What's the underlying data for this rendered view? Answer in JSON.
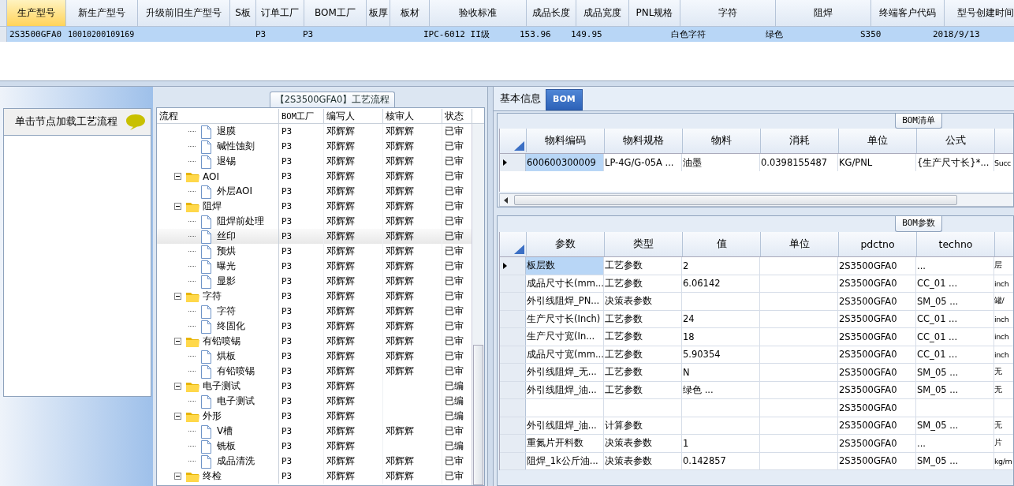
{
  "top_grid": {
    "columns": [
      {
        "label": "生产型号",
        "selected": true
      },
      {
        "label": "新生产型号",
        "selected": false
      },
      {
        "label": "升级前旧生产型号",
        "selected": false
      },
      {
        "label": "S板",
        "selected": false
      },
      {
        "label": "订单工厂",
        "selected": false
      },
      {
        "label": "BOM工厂",
        "selected": false
      },
      {
        "label": "板厚",
        "selected": false
      },
      {
        "label": "板材",
        "selected": false
      },
      {
        "label": "验收标准",
        "selected": false
      },
      {
        "label": "成品长度",
        "selected": false
      },
      {
        "label": "成品宽度",
        "selected": false
      },
      {
        "label": "PNL规格",
        "selected": false
      },
      {
        "label": "字符",
        "selected": false
      },
      {
        "label": "阻焊",
        "selected": false
      },
      {
        "label": "终端客户代码",
        "selected": false
      },
      {
        "label": "型号创建时间",
        "selected": false
      }
    ],
    "rows": [
      {
        "selected": true,
        "cells": [
          "2S3500GFA0",
          "10010200109169",
          "",
          "",
          "P3",
          "P3",
          "",
          "",
          "IPC-6012 II级",
          "153.96",
          "149.95",
          "",
          "白色字符",
          "绿色",
          "S350",
          "2018/9/13"
        ]
      }
    ]
  },
  "left_panel": {
    "hint": "单击节点加载工艺流程"
  },
  "process_panel": {
    "title": "【2S3500GFA0】工艺流程",
    "columns": [
      "流程",
      "BOM工厂",
      "编写人",
      "核审人",
      "状态"
    ],
    "tree": [
      {
        "children": [
          {
            "label": "退膜",
            "selected": false,
            "cells": [
              "P3",
              "邓辉辉",
              "邓辉辉",
              "已审"
            ]
          },
          {
            "label": "碱性蚀刻",
            "selected": false,
            "cells": [
              "P3",
              "邓辉辉",
              "邓辉辉",
              "已审"
            ]
          },
          {
            "label": "退锡",
            "selected": false,
            "cells": [
              "P3",
              "邓辉辉",
              "邓辉辉",
              "已审"
            ]
          }
        ]
      },
      {
        "label": "AOI",
        "selected": false,
        "expanded": true,
        "cells": [
          "P3",
          "邓辉辉",
          "邓辉辉",
          "已审"
        ],
        "children": [
          {
            "label": "外层AOI",
            "selected": false,
            "cells": [
              "P3",
              "邓辉辉",
              "邓辉辉",
              "已审"
            ]
          }
        ]
      },
      {
        "label": "阻焊",
        "selected": false,
        "expanded": true,
        "cells": [
          "P3",
          "邓辉辉",
          "邓辉辉",
          "已审"
        ],
        "children": [
          {
            "label": "阻焊前处理",
            "selected": false,
            "cells": [
              "P3",
              "邓辉辉",
              "邓辉辉",
              "已审"
            ]
          },
          {
            "label": "丝印",
            "selected": true,
            "cells": [
              "P3",
              "邓辉辉",
              "邓辉辉",
              "已审"
            ]
          },
          {
            "label": "预烘",
            "selected": false,
            "cells": [
              "P3",
              "邓辉辉",
              "邓辉辉",
              "已审"
            ]
          },
          {
            "label": "曝光",
            "selected": false,
            "cells": [
              "P3",
              "邓辉辉",
              "邓辉辉",
              "已审"
            ]
          },
          {
            "label": "显影",
            "selected": false,
            "cells": [
              "P3",
              "邓辉辉",
              "邓辉辉",
              "已审"
            ]
          }
        ]
      },
      {
        "label": "字符",
        "selected": false,
        "expanded": true,
        "cells": [
          "P3",
          "邓辉辉",
          "邓辉辉",
          "已审"
        ],
        "children": [
          {
            "label": "字符",
            "selected": false,
            "cells": [
              "P3",
              "邓辉辉",
              "邓辉辉",
              "已审"
            ]
          },
          {
            "label": "终固化",
            "selected": false,
            "cells": [
              "P3",
              "邓辉辉",
              "邓辉辉",
              "已审"
            ]
          }
        ]
      },
      {
        "label": "有铅喷锡",
        "selected": false,
        "expanded": true,
        "cells": [
          "P3",
          "邓辉辉",
          "邓辉辉",
          "已审"
        ],
        "children": [
          {
            "label": "烘板",
            "selected": false,
            "cells": [
              "P3",
              "邓辉辉",
              "邓辉辉",
              "已审"
            ]
          },
          {
            "label": "有铅喷锡",
            "selected": false,
            "cells": [
              "P3",
              "邓辉辉",
              "邓辉辉",
              "已审"
            ]
          }
        ]
      },
      {
        "label": "电子测试",
        "selected": false,
        "expanded": true,
        "cells": [
          "P3",
          "邓辉辉",
          "",
          "已编"
        ],
        "children": [
          {
            "label": "电子测试",
            "selected": false,
            "cells": [
              "P3",
              "邓辉辉",
              "",
              "已编"
            ]
          }
        ]
      },
      {
        "label": "外形",
        "selected": false,
        "expanded": true,
        "cells": [
          "P3",
          "邓辉辉",
          "",
          "已编"
        ],
        "children": [
          {
            "label": "V槽",
            "selected": false,
            "cells": [
              "P3",
              "邓辉辉",
              "邓辉辉",
              "已审"
            ]
          },
          {
            "label": "铣板",
            "selected": false,
            "cells": [
              "P3",
              "邓辉辉",
              "",
              "已编"
            ]
          },
          {
            "label": "成品清洗",
            "selected": false,
            "cells": [
              "P3",
              "邓辉辉",
              "邓辉辉",
              "已审"
            ]
          }
        ]
      },
      {
        "label": "终检",
        "selected": false,
        "expanded": true,
        "cells": [
          "P3",
          "邓辉辉",
          "邓辉辉",
          "已审"
        ]
      }
    ]
  },
  "detail_tabs": [
    {
      "label": "基本信息",
      "selected": false
    },
    {
      "label": "BOM",
      "selected": true
    }
  ],
  "bom_list": {
    "title": "BOM清单",
    "columns": [
      "物料编码",
      "物料规格",
      "物料",
      "消耗",
      "单位",
      "公式"
    ],
    "rows": [
      {
        "selected": true,
        "cells": [
          "600600300009",
          "LP-4G/G-05A ...",
          "油墨",
          "0.0398155487",
          "KG/PNL",
          "{生产尺寸长}*...",
          "Succ"
        ]
      }
    ]
  },
  "bom_params": {
    "title": "BOM参数",
    "columns": [
      "参数",
      "类型",
      "值",
      "单位",
      "pdctno",
      "techno"
    ],
    "rows": [
      {
        "selected": true,
        "cells": [
          "板层数",
          "工艺参数",
          "2",
          "",
          "2S3500GFA0",
          "...",
          "层"
        ]
      },
      {
        "selected": false,
        "cells": [
          "成品尺寸长(mm...",
          "工艺参数",
          "6.06142",
          "",
          "2S3500GFA0",
          "CC_01 ...",
          "inch"
        ]
      },
      {
        "selected": false,
        "cells": [
          "外引线阻焊_PN...",
          "决策表参数",
          "",
          "",
          "2S3500GFA0",
          "SM_05 ...",
          "罐/"
        ]
      },
      {
        "selected": false,
        "cells": [
          "生产尺寸长(Inch)",
          "工艺参数",
          "24",
          "",
          "2S3500GFA0",
          "CC_01 ...",
          "inch"
        ]
      },
      {
        "selected": false,
        "cells": [
          "生产尺寸宽(In...",
          "工艺参数",
          "18",
          "",
          "2S3500GFA0",
          "CC_01 ...",
          "inch"
        ]
      },
      {
        "selected": false,
        "cells": [
          "成品尺寸宽(mm...",
          "工艺参数",
          "5.90354",
          "",
          "2S3500GFA0",
          "CC_01 ...",
          "inch"
        ]
      },
      {
        "selected": false,
        "cells": [
          "外引线阻焊_无...",
          "工艺参数",
          "N",
          "",
          "2S3500GFA0",
          "SM_05 ...",
          "无"
        ]
      },
      {
        "selected": false,
        "cells": [
          "外引线阻焊_油...",
          "工艺参数",
          "绿色 ...",
          "",
          "2S3500GFA0",
          "SM_05 ...",
          "无"
        ]
      },
      {
        "selected": false,
        "cells": [
          "",
          "",
          "",
          "",
          "2S3500GFA0",
          "",
          ""
        ]
      },
      {
        "selected": false,
        "cells": [
          "外引线阻焊_油...",
          "计算参数",
          "",
          "",
          "2S3500GFA0",
          "SM_05 ...",
          "无"
        ]
      },
      {
        "selected": false,
        "cells": [
          "重氮片开料数",
          "决策表参数",
          "1",
          "",
          "2S3500GFA0",
          "...",
          "片"
        ]
      },
      {
        "selected": false,
        "cells": [
          "阻焊_1k公斤油...",
          "决策表参数",
          "0.142857",
          "",
          "2S3500GFA0",
          "SM_05 ...",
          "kg/m"
        ]
      }
    ]
  }
}
